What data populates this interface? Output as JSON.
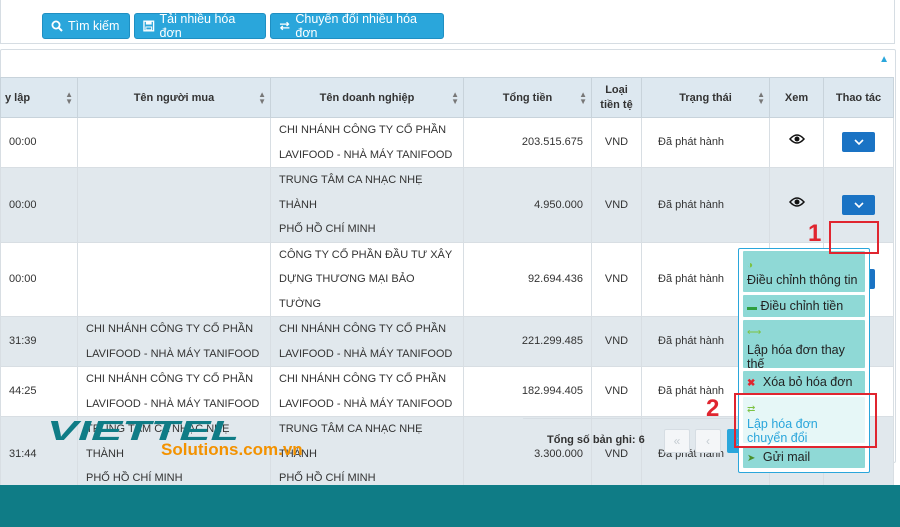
{
  "toolbar": {
    "search_label": "Tìm kiếm",
    "upload_label": "Tải nhiều hóa đơn",
    "convert_label": "Chuyển đổi nhiều hóa đơn"
  },
  "table": {
    "headers": {
      "date": "y lập",
      "buyer": "Tên người mua",
      "company": "Tên doanh nghiệp",
      "total": "Tổng tiền",
      "currency_line1": "Loại",
      "currency_line2": "tiền tệ",
      "status": "Trạng thái",
      "view": "Xem",
      "action": "Thao tác"
    },
    "rows": [
      {
        "time": "00:00",
        "buyer1": "",
        "buyer2": "",
        "company1": "CHI NHÁNH CÔNG TY CỔ PHẦN",
        "company2": "LAVIFOOD - NHÀ MÁY TANIFOOD",
        "total": "203.515.675",
        "currency": "VND",
        "status": "Đã phát hành"
      },
      {
        "time": "00:00",
        "buyer1": "",
        "buyer2": "",
        "company1": "TRUNG TÂM CA NHẠC NHẸ THÀNH",
        "company2": "PHỐ HỒ CHÍ MINH",
        "total": "4.950.000",
        "currency": "VND",
        "status": "Đã phát hành"
      },
      {
        "time": "00:00",
        "buyer1": "",
        "buyer2": "",
        "company1": "CÔNG TY CỔ PHẦN ĐẦU TƯ XÂY",
        "company2": "DỰNG THƯƠNG MẠI BẢO TƯỜNG",
        "total": "92.694.436",
        "currency": "VND",
        "status": "Đã phát hành"
      },
      {
        "time": "31:39",
        "buyer1": "CHI NHÁNH CÔNG TY CỔ PHẦN",
        "buyer2": "LAVIFOOD - NHÀ MÁY TANIFOOD",
        "company1": "CHI NHÁNH CÔNG TY CỔ PHẦN",
        "company2": "LAVIFOOD - NHÀ MÁY TANIFOOD",
        "total": "221.299.485",
        "currency": "VND",
        "status": "Đã phát hành"
      },
      {
        "time": "44:25",
        "buyer1": "CHI NHÁNH CÔNG TY CỔ PHẦN",
        "buyer2": "LAVIFOOD - NHÀ MÁY TANIFOOD",
        "company1": "CHI NHÁNH CÔNG TY CỔ PHẦN",
        "company2": "LAVIFOOD - NHÀ MÁY TANIFOOD",
        "total": "182.994.405",
        "currency": "VND",
        "status": "Đã phát hành"
      },
      {
        "time": "31:44",
        "buyer1": "TRUNG TÂM CA NHẠC NHẸ THÀNH",
        "buyer2": "PHỐ HỒ CHÍ MINH",
        "company1": "TRUNG TÂM CA NHẠC NHẸ THÀNH",
        "company2": "PHỐ HỒ CHÍ MINH",
        "total": "3.300.000",
        "currency": "VND",
        "status": "Đã phát hành"
      }
    ]
  },
  "footer": {
    "total_label": "Tổng số bản ghi: 6",
    "page_first": "«",
    "page_prev": "‹",
    "page_current": "1"
  },
  "logo": {
    "brand": "VIETTEL",
    "suffix": "Solutions.com.vn"
  },
  "dropdown": {
    "items": [
      {
        "label": "Điều chỉnh thông tin"
      },
      {
        "label": "Điều chỉnh tiền"
      },
      {
        "label": "Lập hóa đơn thay thế"
      },
      {
        "label": "Xóa bỏ hóa đơn"
      },
      {
        "label": "Lập hóa đơn chuyển đổi"
      },
      {
        "label": "Gửi mail"
      }
    ]
  },
  "annotations": {
    "marker1": "1",
    "marker2": "2"
  },
  "colors": {
    "accent": "#2aa6db",
    "action_button": "#1a73c4",
    "header_bg": "#dde8f0",
    "menu_item_bg": "#8fd9d6",
    "annotation_red": "#e0252f",
    "bottom_bar": "#0f7c86",
    "logo_orange": "#f39200"
  }
}
